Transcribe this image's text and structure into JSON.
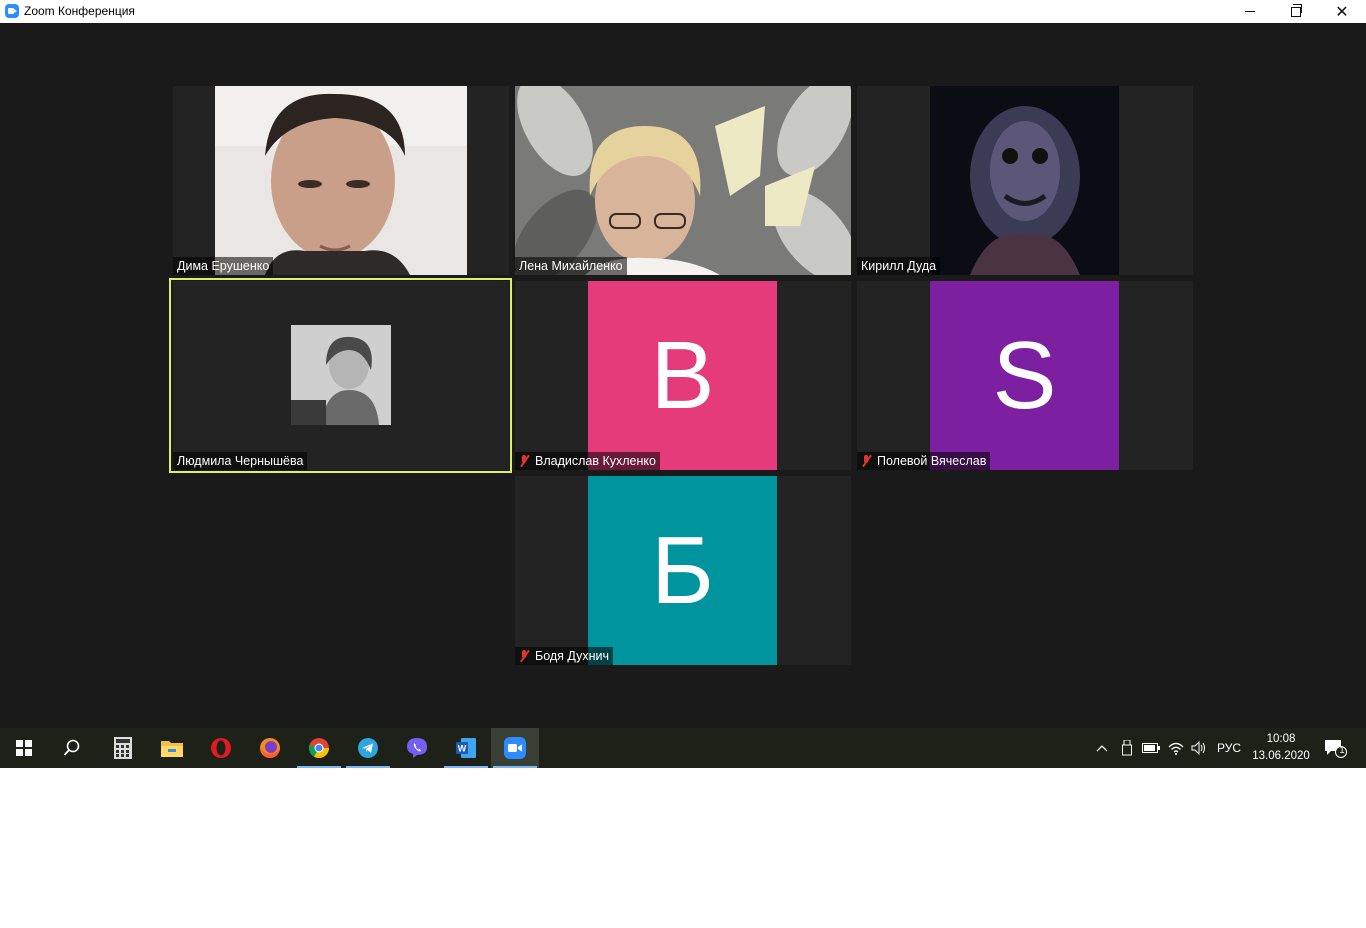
{
  "window": {
    "title": "Zoom Конференция",
    "controls": {
      "minimize": "—",
      "maximize": "❐",
      "close": "✕"
    }
  },
  "participants": [
    {
      "name": "Дима Ерушенко",
      "type": "video",
      "muted": false
    },
    {
      "name": "Лена Михайленко",
      "type": "video",
      "muted": false
    },
    {
      "name": "Кирилл Дуда",
      "type": "video",
      "muted": false
    },
    {
      "name": "Людмила Чернышёва",
      "type": "photo",
      "muted": false,
      "active_speaker": true
    },
    {
      "name": "Владислав Кухленко",
      "type": "initial",
      "initial": "В",
      "color": "#e63b7a",
      "muted": true
    },
    {
      "name": "Полевой Вячеслав",
      "type": "initial",
      "initial": "S",
      "color": "#7c1fa0",
      "muted": true
    },
    {
      "name": "Бодя Духнич",
      "type": "initial",
      "initial": "Б",
      "color": "#00959e",
      "muted": true
    }
  ],
  "taskbar": {
    "apps": [
      {
        "icon": "windows-start-icon"
      },
      {
        "icon": "search-icon"
      },
      {
        "icon": "calculator-icon"
      },
      {
        "icon": "file-explorer-icon"
      },
      {
        "icon": "opera-icon"
      },
      {
        "icon": "firefox-icon"
      },
      {
        "icon": "chrome-icon"
      },
      {
        "icon": "telegram-icon"
      },
      {
        "icon": "viber-icon"
      },
      {
        "icon": "word-icon"
      },
      {
        "icon": "zoom-icon",
        "active": true
      }
    ],
    "tray": {
      "language": "РУС",
      "time": "10:08",
      "date": "13.06.2020",
      "notifications": "1"
    }
  },
  "colors": {
    "stage_bg": "#1a1a1a",
    "tile_bg": "#232323",
    "active_speaker_border": "#d8f06a",
    "taskbar_bg": "#1d2118"
  }
}
